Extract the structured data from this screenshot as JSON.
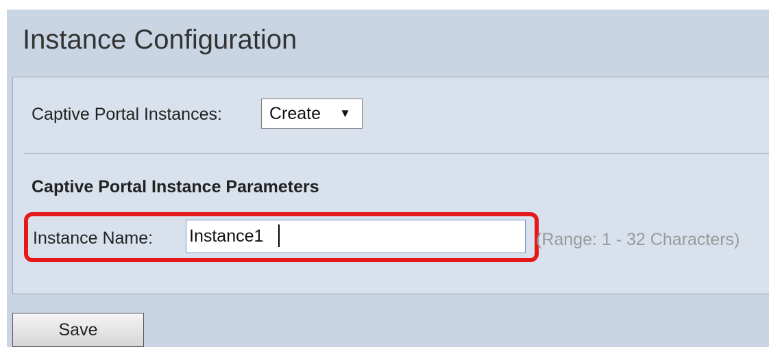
{
  "page": {
    "title": "Instance Configuration"
  },
  "instances_row": {
    "label": "Captive Portal Instances:",
    "selected_value": "Create",
    "arrow_icon": "triangle-down-icon"
  },
  "parameters": {
    "heading": "Captive Portal Instance Parameters",
    "instance_name": {
      "label": "Instance Name:",
      "value": "Instance1",
      "hint": "(Range: 1 - 32 Characters)"
    }
  },
  "actions": {
    "save_label": "Save"
  },
  "colors": {
    "frame_background": "#c9d5e3",
    "panel_background": "#d8e1ec",
    "highlight": "#e41a1a",
    "input_border": "#6d8fc4",
    "hint_text": "#9a9a9a"
  }
}
